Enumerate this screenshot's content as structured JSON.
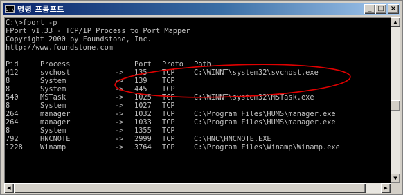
{
  "window": {
    "title_icon": "C:\\",
    "title": "명령 프롬프트",
    "buttons": {
      "minimize": "_",
      "maximize": "□",
      "close": "×"
    }
  },
  "console": {
    "header_lines": [
      "C:\\>fport -p",
      "FPort v1.33 - TCP/IP Process to Port Mapper",
      "Copyright 2000 by Foundstone, Inc.",
      "http://www.foundstone.com"
    ],
    "columns": {
      "pid": "Pid",
      "process": "Process",
      "port": "Port",
      "proto": "Proto",
      "path": "Path"
    },
    "rows": [
      {
        "pid": "412",
        "process": "svchost",
        "arrow": "->",
        "port": "135",
        "proto": "TCP",
        "path": "C:\\WINNT\\system32\\svchost.exe"
      },
      {
        "pid": "8",
        "process": "System",
        "arrow": "->",
        "port": "139",
        "proto": "TCP",
        "path": ""
      },
      {
        "pid": "8",
        "process": "System",
        "arrow": "->",
        "port": "445",
        "proto": "TCP",
        "path": ""
      },
      {
        "pid": "540",
        "process": "MSTask",
        "arrow": "->",
        "port": "1025",
        "proto": "TCP",
        "path": "C:\\WINNT\\system32\\MSTask.exe"
      },
      {
        "pid": "8",
        "process": "System",
        "arrow": "->",
        "port": "1027",
        "proto": "TCP",
        "path": ""
      },
      {
        "pid": "264",
        "process": "manager",
        "arrow": "->",
        "port": "1032",
        "proto": "TCP",
        "path": "C:\\Program Files\\HUMS\\manager.exe"
      },
      {
        "pid": "264",
        "process": "manager",
        "arrow": "->",
        "port": "1033",
        "proto": "TCP",
        "path": "C:\\Program Files\\HUMS\\manager.exe"
      },
      {
        "pid": "8",
        "process": "System",
        "arrow": "->",
        "port": "1355",
        "proto": "TCP",
        "path": ""
      },
      {
        "pid": "792",
        "process": "HNCNOTE",
        "arrow": "->",
        "port": "2999",
        "proto": "TCP",
        "path": "C:\\HNC\\HNCNOTE.EXE"
      },
      {
        "pid": "1228",
        "process": "Winamp",
        "arrow": "->",
        "port": "3764",
        "proto": "TCP",
        "path": "C:\\Program Files\\Winamp\\Winamp.exe"
      }
    ]
  },
  "colors": {
    "console_bg": "#000000",
    "console_text": "#c0c0c0",
    "annotation": "#e00000",
    "title_start": "#0a246a",
    "title_end": "#a6caf0"
  },
  "scrollbar": {
    "up": "▲",
    "down": "▼",
    "left": "◀",
    "right": "▶"
  }
}
